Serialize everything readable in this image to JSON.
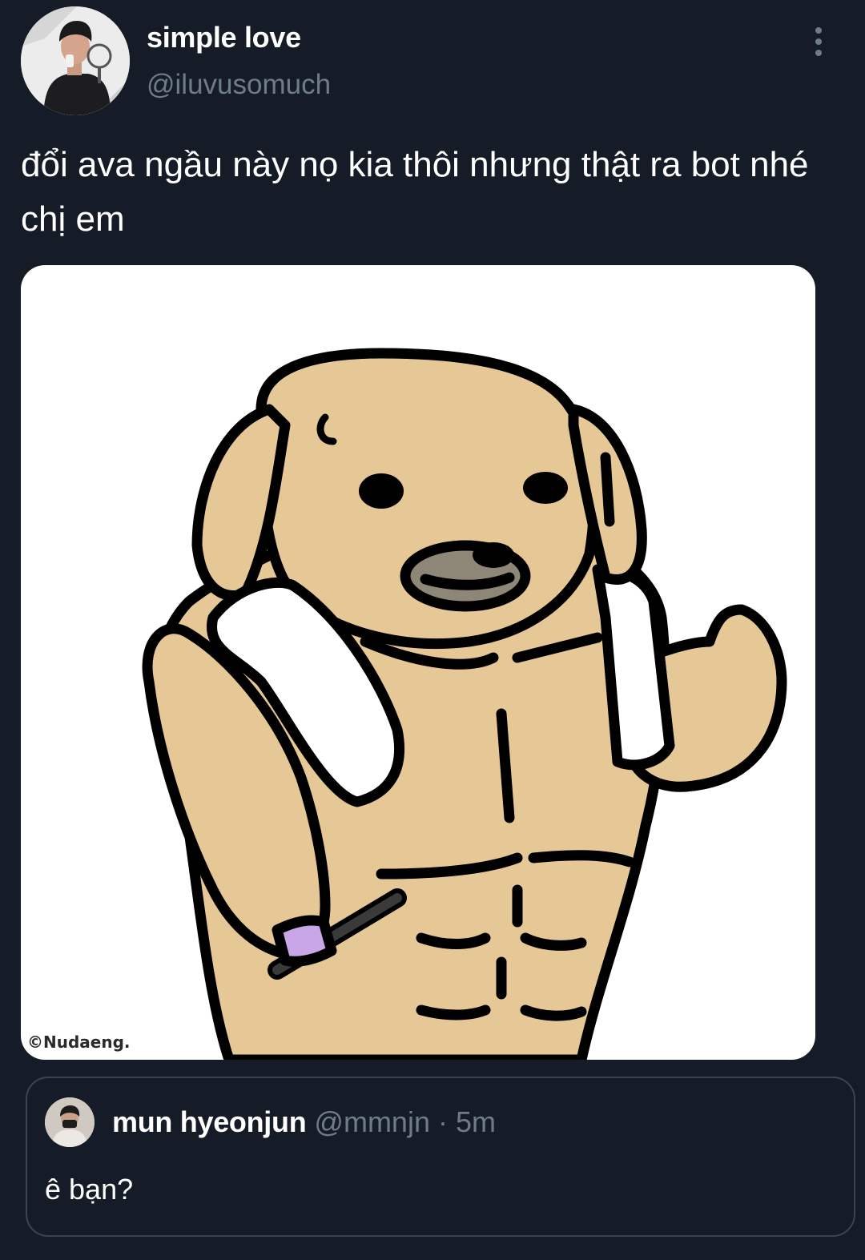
{
  "tweet": {
    "author": {
      "display_name": "simple love",
      "handle": "@iluvusomuch"
    },
    "more_icon": "vertical-dots-icon",
    "text": "đổi ava ngầu này nọ kia thôi nhưng thật ra bot nhé chị em",
    "media": {
      "watermark": "©Nudaeng.",
      "colors": {
        "fur": "#e6c897",
        "outline": "#000000",
        "towel": "#ffffff",
        "muzzle": "#8e8676",
        "wristband": "#c9a6e8"
      }
    }
  },
  "quoted_tweet": {
    "display_name": "mun hyeonjun",
    "handle": "@mmnjn",
    "separator": "·",
    "time": "5m",
    "text": "ê bạn?"
  },
  "colors": {
    "background": "#151c27",
    "secondary_text": "#6e7c89",
    "border": "#3a4553"
  }
}
